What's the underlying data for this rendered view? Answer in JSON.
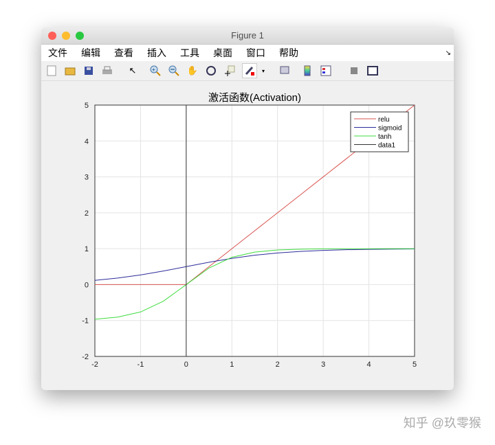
{
  "window": {
    "title": "Figure 1"
  },
  "menu": [
    "文件",
    "编辑",
    "查看",
    "插入",
    "工具",
    "桌面",
    "窗口",
    "帮助"
  ],
  "watermark": "知乎 @玖零猴",
  "chart_data": {
    "type": "line",
    "title": "激活函数(Activation)",
    "xlabel": "",
    "ylabel": "",
    "xlim": [
      -2,
      5
    ],
    "ylim": [
      -2,
      5
    ],
    "xticks": [
      -2,
      -1,
      0,
      1,
      2,
      3,
      4,
      5
    ],
    "yticks": [
      -2,
      -1,
      0,
      1,
      2,
      3,
      4,
      5
    ],
    "grid": true,
    "legend_position": "top-right",
    "series": [
      {
        "name": "relu",
        "color": "#d9534f",
        "x": [
          -2,
          -1.5,
          -1,
          -0.5,
          0,
          0.5,
          1,
          1.5,
          2,
          2.5,
          3,
          3.5,
          4,
          4.5,
          5
        ],
        "y": [
          0,
          0,
          0,
          0,
          0,
          0.5,
          1,
          1.5,
          2,
          2.5,
          3,
          3.5,
          4,
          4.5,
          5
        ]
      },
      {
        "name": "sigmoid",
        "color": "#2b2b9a",
        "x": [
          -2,
          -1.5,
          -1,
          -0.5,
          0,
          0.5,
          1,
          1.5,
          2,
          2.5,
          3,
          3.5,
          4,
          4.5,
          5
        ],
        "y": [
          0.119,
          0.182,
          0.269,
          0.378,
          0.5,
          0.622,
          0.731,
          0.818,
          0.881,
          0.924,
          0.953,
          0.971,
          0.982,
          0.989,
          0.993
        ]
      },
      {
        "name": "tanh",
        "color": "#3ddc3d",
        "x": [
          -2,
          -1.5,
          -1,
          -0.5,
          0,
          0.5,
          1,
          1.5,
          2,
          2.5,
          3,
          3.5,
          4,
          4.5,
          5
        ],
        "y": [
          -0.964,
          -0.905,
          -0.762,
          -0.462,
          0,
          0.462,
          0.762,
          0.905,
          0.964,
          0.987,
          0.995,
          0.998,
          0.999,
          1.0,
          1.0
        ]
      },
      {
        "name": "data1",
        "color": "#333333",
        "x": [
          0,
          0
        ],
        "y": [
          -2,
          5
        ]
      }
    ]
  }
}
